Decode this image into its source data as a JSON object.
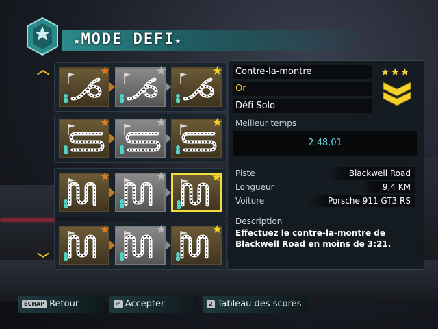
{
  "header": {
    "title": "MODE DEFI",
    "star": "★"
  },
  "nav": {
    "up": "︿",
    "down": "﹀"
  },
  "grid": {
    "rows": [
      {
        "type": "circuit-loop",
        "tiles": [
          "bronze",
          "silver",
          "gold"
        ]
      },
      {
        "type": "sprint-s",
        "tiles": [
          "bronze",
          "silver",
          "gold"
        ]
      },
      {
        "type": "drift",
        "tiles": [
          "bronze",
          "silver",
          "gold"
        ],
        "selected": 2
      },
      {
        "type": "drift",
        "tiles": [
          "bronze",
          "silver",
          "gold"
        ]
      }
    ],
    "medal_glyph": "★"
  },
  "detail": {
    "event_type": "Contre-la-montre",
    "tier": "Or",
    "mode": "Défi Solo",
    "stars": "★★★",
    "best_time_label": "Meilleur temps",
    "best_time": "2:48.01",
    "track_label": "Piste",
    "track": "Blackwell Road",
    "length_label": "Longueur",
    "length": "9,4 KM",
    "car_label": "Voiture",
    "car": "Porsche 911 GT3 RS",
    "description_label": "Description",
    "description": "Effectuez le contre-la-montre de Blackwell Road en moins de 3:21."
  },
  "footer": {
    "back_key": "ÉCHAP",
    "back": "Retour",
    "accept_key": "↵",
    "accept": "Accepter",
    "scores_key": "2",
    "scores": "Tableau des scores"
  },
  "colors": {
    "accent": "#2d8a8c",
    "gold": "#f3d22a",
    "bronze": "#e07b20",
    "silver": "#b8b8b8"
  }
}
